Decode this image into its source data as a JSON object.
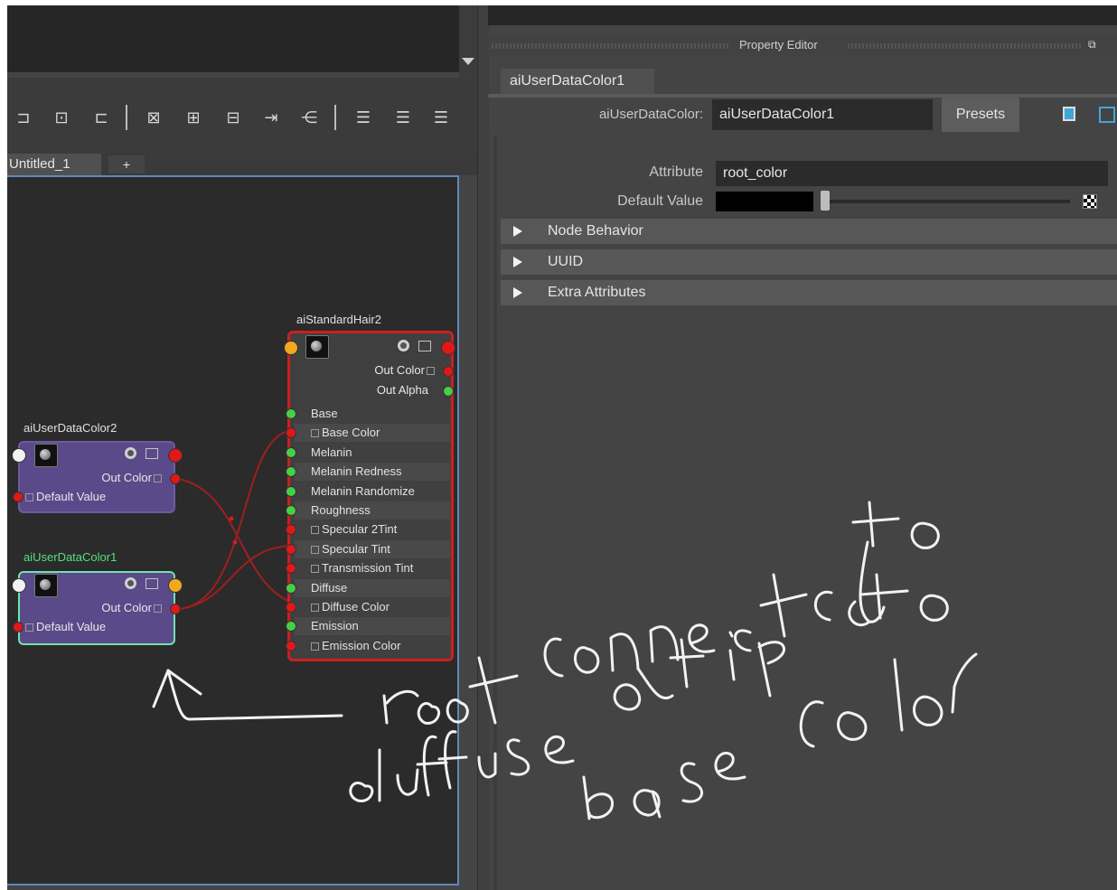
{
  "node_editor": {
    "tab": {
      "label": "Untitled_1",
      "add_label": "+"
    },
    "nodes": {
      "user_data_color_2": {
        "title": "aiUserDataColor2",
        "out_port": "Out Color",
        "in_port": "Default Value"
      },
      "user_data_color_1": {
        "title": "aiUserDataColor1",
        "out_port": "Out Color",
        "in_port": "Default Value"
      },
      "standard_hair_2": {
        "title": "aiStandardHair2",
        "outputs": [
          "Out Color",
          "Out Alpha"
        ],
        "inputs": [
          "Base",
          "Base Color",
          "Melanin",
          "Melanin Redness",
          "Melanin Randomize",
          "Roughness",
          "Specular 2Tint",
          "Specular Tint",
          "Transmission Tint",
          "Diffuse",
          "Diffuse Color",
          "Emission",
          "Emission Color"
        ]
      }
    }
  },
  "property_editor": {
    "header_title": "Property Editor",
    "tab_label": "aiUserDataColor1",
    "node_label": "aiUserDataColor:",
    "node_value": "aiUserDataColor1",
    "presets_label": "Presets",
    "attribute_label": "Attribute",
    "attribute_value": "root_color",
    "default_value_label": "Default Value",
    "default_value_color": "#000000",
    "sections": [
      "Node Behavior",
      "UUID",
      "Extra Attributes"
    ]
  },
  "colors": {
    "wire": "#a01f1f",
    "selection": "#6fe3b4",
    "hair_border": "#cc1f1f",
    "node_purple": "#5a4a8a",
    "graph_border": "#5d89b8"
  }
}
